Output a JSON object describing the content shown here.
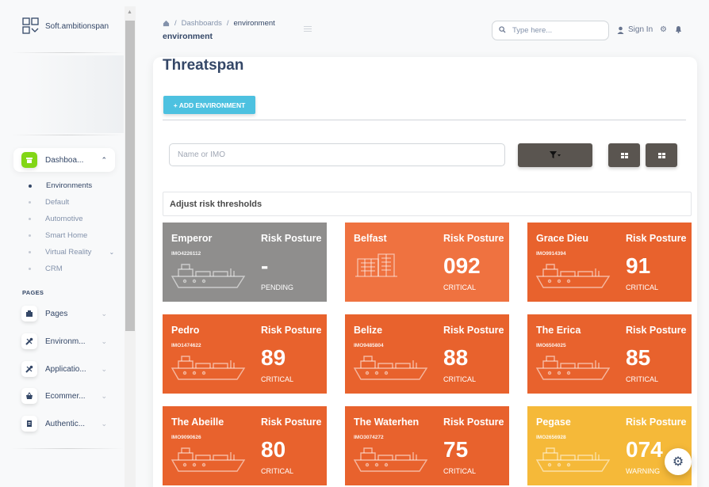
{
  "brand": {
    "name": "Soft.ambitionspan"
  },
  "sidebar": {
    "active": {
      "label": "Dashboa...",
      "icon": "shop-icon"
    },
    "sub_items": [
      {
        "label": "Environments",
        "active": true
      },
      {
        "label": "Default",
        "active": false
      },
      {
        "label": "Automotive",
        "active": false
      },
      {
        "label": "Smart Home",
        "active": false
      },
      {
        "label": "Virtual Reality",
        "active": false,
        "has_caret": true
      },
      {
        "label": "CRM",
        "active": false
      }
    ],
    "section_label": "PAGES",
    "items": [
      {
        "label": "Pages",
        "icon": "office-icon"
      },
      {
        "label": "Environm...",
        "icon": "tools-icon"
      },
      {
        "label": "Applicatio...",
        "icon": "tools-icon"
      },
      {
        "label": "Ecommer...",
        "icon": "basket-icon"
      },
      {
        "label": "Authentic...",
        "icon": "document-icon"
      }
    ]
  },
  "navbar": {
    "breadcrumb": [
      "Dashboards",
      "environment"
    ],
    "page_heading": "environment",
    "search_placeholder": "Type here...",
    "signin_label": "Sign In"
  },
  "main": {
    "title": "Threatspan",
    "add_button": "+ ADD ENVIRONMENT",
    "name_placeholder": "Name or IMO",
    "adjust_label": "Adjust risk thresholds",
    "risk_label": "Risk Posture"
  },
  "colors": {
    "critical": "#e8622d",
    "critical_light": "#ef7240",
    "pending": "#8f8e8d",
    "warning": "#f5b939",
    "info": "#4dc1e0",
    "dark_button": "#5a5550"
  },
  "tiles": [
    {
      "name": "Emperor",
      "imo": "IMO4226112",
      "score": "-",
      "status": "PENDING",
      "color": "#8f8e8d",
      "art": "ship"
    },
    {
      "name": "Belfast",
      "imo": "",
      "score": "092",
      "status": "CRITICAL",
      "color": "#ef7240",
      "art": "building"
    },
    {
      "name": "Grace Dieu",
      "imo": "IMO9914394",
      "score": "91",
      "status": "CRITICAL",
      "color": "#e8622d",
      "art": "ship"
    },
    {
      "name": "Pedro",
      "imo": "IMO1474622",
      "score": "89",
      "status": "CRITICAL",
      "color": "#e8622d",
      "art": "ship"
    },
    {
      "name": "Belize",
      "imo": "IMO9485804",
      "score": "88",
      "status": "CRITICAL",
      "color": "#e8622d",
      "art": "ship"
    },
    {
      "name": "The Erica",
      "imo": "IMO6504025",
      "score": "85",
      "status": "CRITICAL",
      "color": "#e8622d",
      "art": "ship"
    },
    {
      "name": "The Abeille",
      "imo": "IMO9090626",
      "score": "80",
      "status": "CRITICAL",
      "color": "#e8622d",
      "art": "ship"
    },
    {
      "name": "The Waterhen",
      "imo": "IMO3074272",
      "score": "75",
      "status": "CRITICAL",
      "color": "#e8622d",
      "art": "ship"
    },
    {
      "name": "Pegase",
      "imo": "IMO2656928",
      "score": "074",
      "status": "WARNING",
      "color": "#f5b939",
      "art": "ship"
    }
  ]
}
